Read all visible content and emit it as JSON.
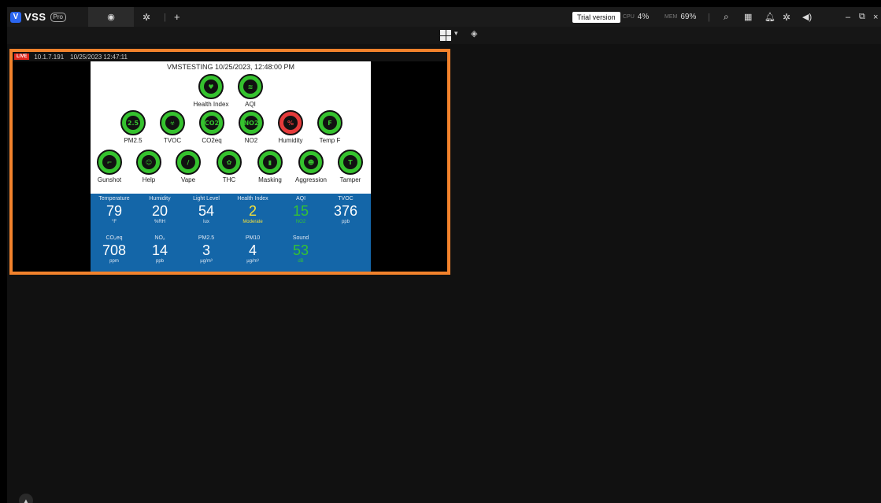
{
  "app": {
    "name": "VSS",
    "badge": "Pro"
  },
  "tabs": {
    "plus": "+"
  },
  "status": {
    "trial": "Trial version",
    "cpu_label": "CPU",
    "cpu_value": "4%",
    "mem_label": "MEM",
    "mem_value": "69%"
  },
  "window": {
    "minimize": "–",
    "restore": "⧉",
    "close": "×"
  },
  "tile": {
    "live": "LIVE",
    "ip": "10.1.7.191",
    "timestamp": "10/25/2023 12:47:11",
    "screen_title": "VMSTESTING 10/25/2023, 12:48:00 PM",
    "top_icons": [
      {
        "label": "Health Index",
        "glyph": "♥"
      },
      {
        "label": "AQI",
        "glyph": "≋"
      }
    ],
    "row2_icons": [
      {
        "label": "PM2.5",
        "glyph": "2.5"
      },
      {
        "label": "TVOC",
        "glyph": "☣"
      },
      {
        "label": "CO2eq",
        "glyph": "CO2"
      },
      {
        "label": "NO2",
        "glyph": "NO2"
      },
      {
        "label": "Humidity",
        "glyph": "%"
      },
      {
        "label": "Temp F",
        "glyph": "F"
      }
    ],
    "row3_icons": [
      {
        "label": "Gunshot",
        "glyph": "⌐"
      },
      {
        "label": "Help",
        "glyph": "☺"
      },
      {
        "label": "Vape",
        "glyph": "/"
      },
      {
        "label": "THC",
        "glyph": "✿"
      },
      {
        "label": "Masking",
        "glyph": "▮"
      },
      {
        "label": "Aggression",
        "glyph": "☻"
      },
      {
        "label": "Tamper",
        "glyph": "T"
      }
    ],
    "readings_row1": [
      {
        "head": "Temperature",
        "value": "79",
        "unit": "°F"
      },
      {
        "head": "Humidity",
        "value": "20",
        "unit": "%RH"
      },
      {
        "head": "Light Level",
        "value": "54",
        "unit": "lux"
      },
      {
        "head": "Health Index",
        "value": "2",
        "unit": "Moderate"
      },
      {
        "head": "AQI",
        "value": "15",
        "unit": "NO2"
      },
      {
        "head": "TVOC",
        "value": "376",
        "unit": "ppb"
      }
    ],
    "readings_row2": [
      {
        "head": "CO₂eq",
        "value": "708",
        "unit": "ppm"
      },
      {
        "head": "NO₂",
        "value": "14",
        "unit": "ppb"
      },
      {
        "head": "PM2.5",
        "value": "3",
        "unit": "µg/m³"
      },
      {
        "head": "PM10",
        "value": "4",
        "unit": "µg/m³"
      },
      {
        "head": "Sound",
        "value": "53",
        "unit": "dB"
      }
    ]
  },
  "colors": {
    "accent_border": "#f2822c",
    "panel_blue": "#1466a8",
    "icon_green": "#35c22e",
    "alert_red": "#e53b3b"
  }
}
